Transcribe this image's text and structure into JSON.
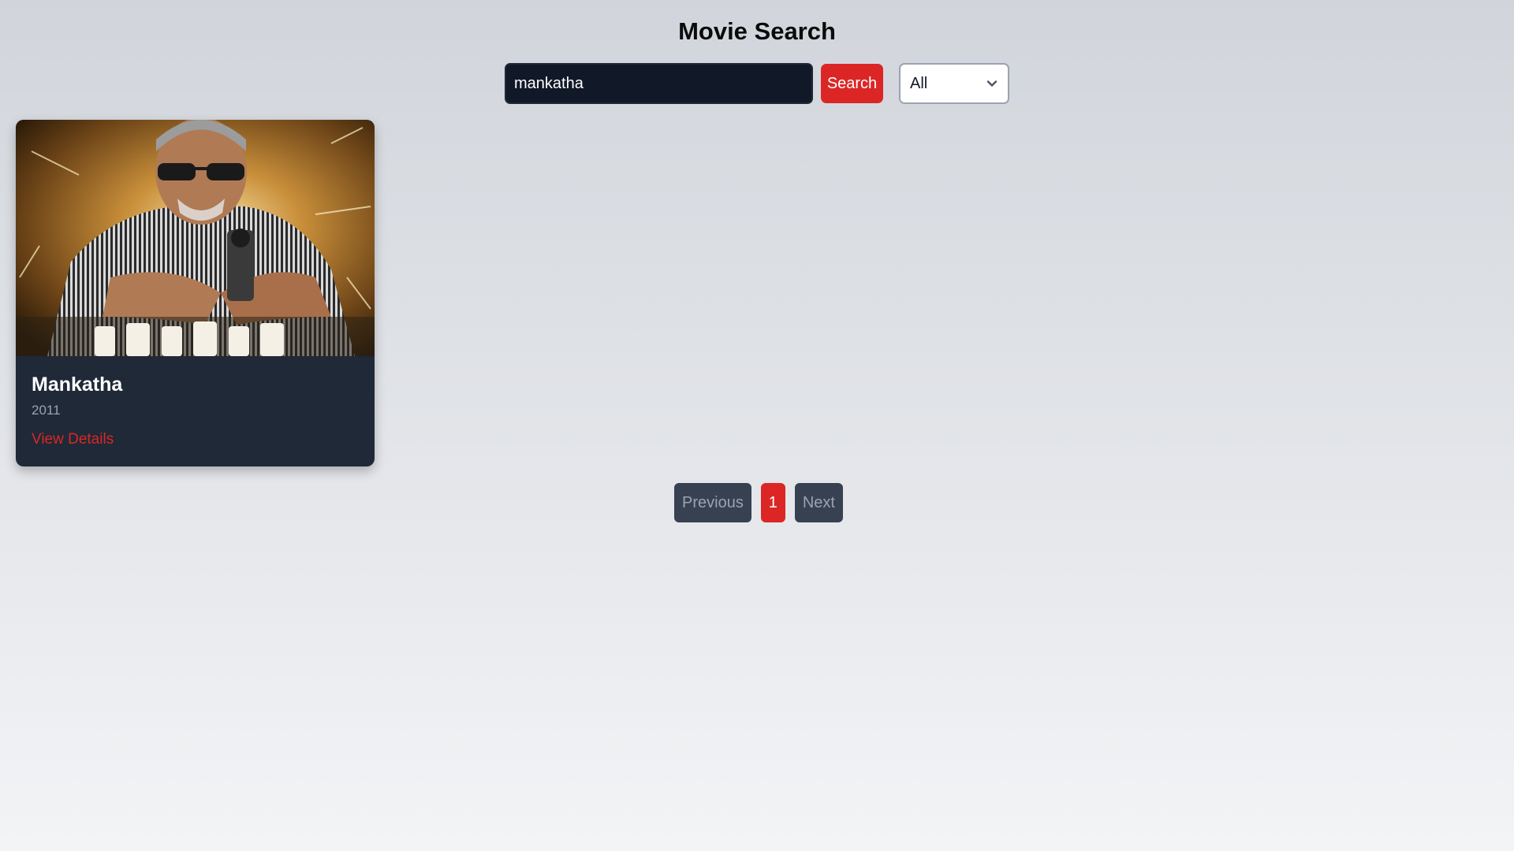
{
  "page": {
    "title": "Movie Search"
  },
  "search": {
    "value": "mankatha",
    "button_label": "Search"
  },
  "filter": {
    "selected": "All",
    "icon": "chevron-down-icon"
  },
  "results": [
    {
      "title": "Mankatha",
      "year": "2011",
      "link_label": "View Details"
    }
  ],
  "pagination": {
    "previous_label": "Previous",
    "current_page": "1",
    "next_label": "Next"
  },
  "colors": {
    "accent": "#dc2626",
    "card_bg": "#1f2937",
    "input_bg": "#111827",
    "pager_bg": "#374151"
  }
}
